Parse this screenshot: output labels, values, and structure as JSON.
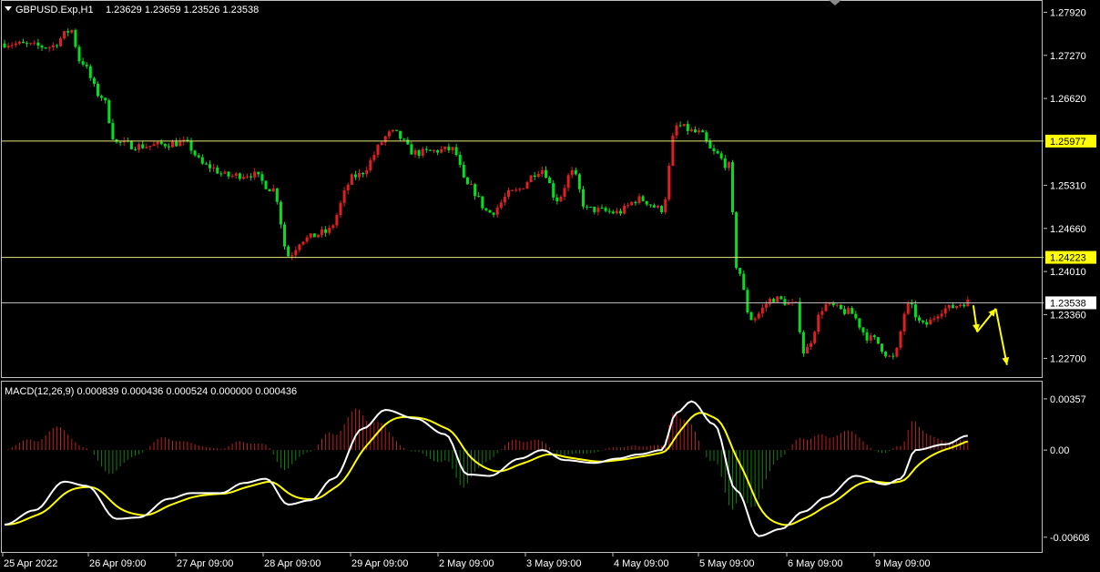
{
  "header": {
    "symbol": "GBPUSD.Exp,H1",
    "ohlc": "1.23629 1.23659 1.23526 1.23538"
  },
  "colors": {
    "background": "#000000",
    "bull": "#e02020",
    "bear": "#00e020",
    "hline": "#e8e87a",
    "current_line": "#b8b8b8",
    "price_tag_yellow": "#ffff00",
    "macd_line": "#ffffff",
    "signal_line": "#ffff00",
    "hist_pos": "#c02020",
    "hist_neg": "#108010",
    "arrow": "#ffff00",
    "frame": "#c0c0c0"
  },
  "chart_data": [
    {
      "type": "candlestick",
      "name": "price",
      "ylim": [
        1.225,
        1.2805
      ],
      "yticks": [
        "1.27920",
        "1.27270",
        "1.26620",
        "1.25310",
        "1.24660",
        "1.24010",
        "1.23360",
        "1.22700"
      ],
      "hlines": [
        {
          "value": 1.25977,
          "label": "1.25977",
          "tag": "yellow"
        },
        {
          "value": 1.24223,
          "label": "1.24223",
          "tag": "yellow"
        },
        {
          "value": 1.23538,
          "label": "1.23538",
          "tag": "white"
        }
      ],
      "xticks": [
        "25 Apr 2022",
        "26 Apr 09:00",
        "27 Apr 09:00",
        "28 Apr 09:00",
        "29 Apr 09:00",
        "2 May 09:00",
        "3 May 09:00",
        "4 May 09:00",
        "5 May 09:00",
        "6 May 09:00",
        "9 May 09:00"
      ],
      "anchors": [
        [
          0,
          1.2745
        ],
        [
          12,
          1.274
        ],
        [
          18,
          1.2765
        ],
        [
          20,
          1.272
        ],
        [
          26,
          1.2665
        ],
        [
          30,
          1.2595
        ],
        [
          36,
          1.259
        ],
        [
          48,
          1.2595
        ],
        [
          54,
          1.256
        ],
        [
          60,
          1.2545
        ],
        [
          66,
          1.2548
        ],
        [
          72,
          1.2525
        ],
        [
          76,
          1.2425
        ],
        [
          80,
          1.245
        ],
        [
          86,
          1.246
        ],
        [
          94,
          1.2545
        ],
        [
          104,
          1.261
        ],
        [
          110,
          1.258
        ],
        [
          120,
          1.2585
        ],
        [
          124,
          1.253
        ],
        [
          130,
          1.249
        ],
        [
          136,
          1.252
        ],
        [
          144,
          1.2555
        ],
        [
          148,
          1.251
        ],
        [
          152,
          1.255
        ],
        [
          156,
          1.2495
        ],
        [
          164,
          1.249
        ],
        [
          170,
          1.251
        ],
        [
          176,
          1.2495
        ],
        [
          180,
          1.262
        ],
        [
          186,
          1.261
        ],
        [
          190,
          1.258
        ],
        [
          194,
          1.256
        ],
        [
          196,
          1.241
        ],
        [
          200,
          1.233
        ],
        [
          206,
          1.236
        ],
        [
          212,
          1.235
        ],
        [
          214,
          1.228
        ],
        [
          220,
          1.235
        ],
        [
          226,
          1.234
        ],
        [
          232,
          1.23
        ],
        [
          238,
          1.227
        ],
        [
          242,
          1.235
        ],
        [
          246,
          1.232
        ],
        [
          252,
          1.2345
        ],
        [
          258,
          1.2355
        ]
      ],
      "arrows": [
        {
          "from": [
            259.5,
            1.235
          ],
          "to": [
            260.5,
            1.231
          ]
        },
        {
          "from": [
            260.5,
            1.231
          ],
          "to": [
            265.5,
            1.2345
          ]
        },
        {
          "from": [
            265.5,
            1.2345
          ],
          "to": [
            268.5,
            1.226
          ]
        }
      ]
    },
    {
      "type": "macd",
      "name": "MACD(12,26,9) 0.000839 0.000436 0.000524 0.000000 0.000436",
      "ylim": [
        -0.0066,
        0.0042
      ],
      "yticks": [
        "0.00357",
        "0.00",
        "-0.00608"
      ],
      "anchors": [
        [
          0,
          -0.0052
        ],
        [
          8,
          -0.0042
        ],
        [
          16,
          -0.0022
        ],
        [
          22,
          -0.0025
        ],
        [
          30,
          -0.0048
        ],
        [
          36,
          -0.0047
        ],
        [
          44,
          -0.0034
        ],
        [
          50,
          -0.003
        ],
        [
          58,
          -0.003
        ],
        [
          64,
          -0.0023
        ],
        [
          70,
          -0.002
        ],
        [
          76,
          -0.0038
        ],
        [
          82,
          -0.0035
        ],
        [
          88,
          -0.002
        ],
        [
          96,
          0.0015
        ],
        [
          102,
          0.0028
        ],
        [
          110,
          0.0022
        ],
        [
          118,
          0.0011
        ],
        [
          124,
          -0.0017
        ],
        [
          130,
          -0.0018
        ],
        [
          138,
          -0.0006
        ],
        [
          144,
          0.0
        ],
        [
          150,
          -0.0007
        ],
        [
          158,
          -0.0009
        ],
        [
          164,
          -0.0006
        ],
        [
          170,
          -0.0003
        ],
        [
          176,
          0.0
        ],
        [
          180,
          0.0026
        ],
        [
          184,
          0.0034
        ],
        [
          190,
          0.0018
        ],
        [
          196,
          -0.0028
        ],
        [
          202,
          -0.006
        ],
        [
          208,
          -0.0055
        ],
        [
          214,
          -0.0043
        ],
        [
          220,
          -0.0033
        ],
        [
          228,
          -0.0018
        ],
        [
          236,
          -0.0024
        ],
        [
          240,
          -0.002
        ],
        [
          244,
          0.0
        ],
        [
          252,
          0.0004
        ],
        [
          258,
          0.001
        ]
      ],
      "signal_period": 9
    }
  ]
}
